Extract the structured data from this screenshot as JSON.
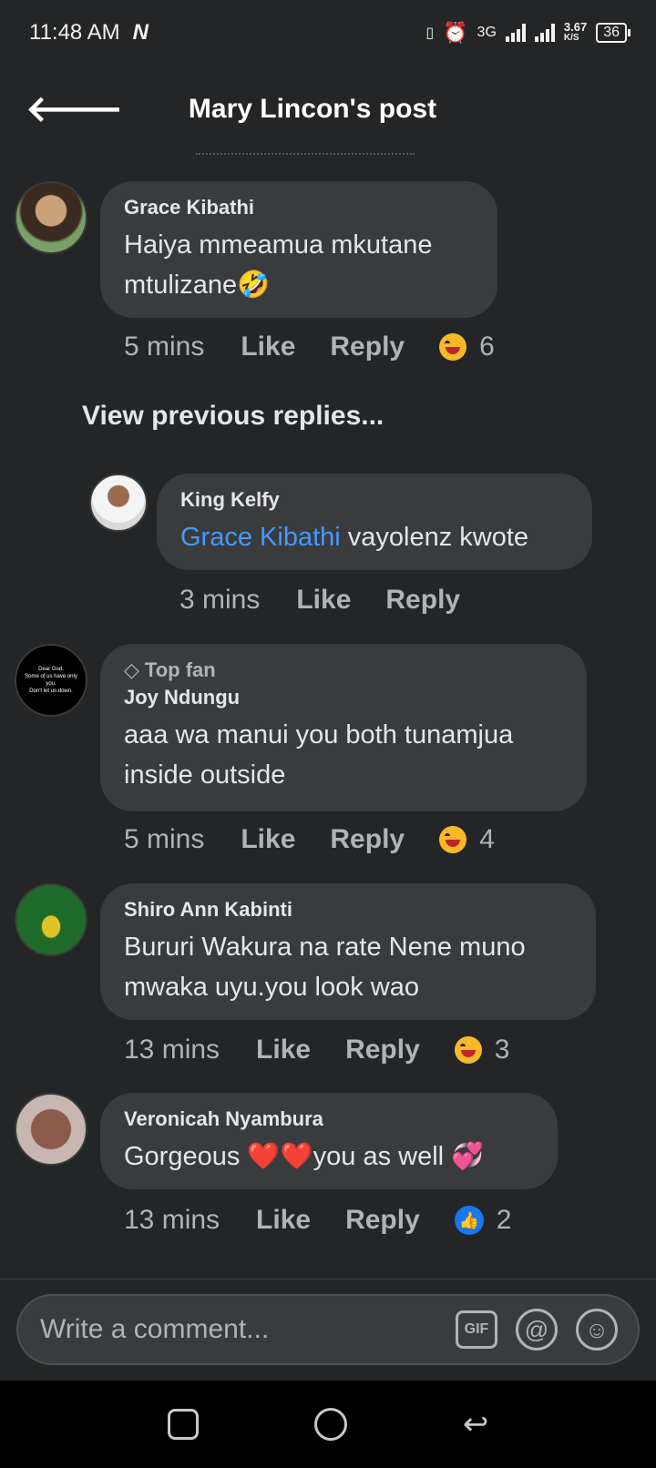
{
  "status": {
    "time": "11:48 AM",
    "carrier_logo": "N",
    "net_type": "3G",
    "speed": "3.67",
    "speed_unit": "K/S",
    "battery": "36"
  },
  "header": {
    "title": "Mary Lincon's post"
  },
  "comments": [
    {
      "name": "Grace Kibathi",
      "text": "Haiya mmeamua mkutane mtulizane🤣",
      "time": "5 mins",
      "like": "Like",
      "reply": "Reply",
      "reaction_count": "6",
      "reaction_icon": "haha"
    },
    {
      "name": "King Kelfy",
      "mention": "Grace Kibathi",
      "text": " vayolenz kwote",
      "time": "3 mins",
      "like": "Like",
      "reply": "Reply"
    },
    {
      "badge": "Top fan",
      "name": "Joy Ndungu",
      "text": "aaa wa manui you both tunamjua inside outside",
      "time": "5 mins",
      "like": "Like",
      "reply": "Reply",
      "reaction_count": "4",
      "reaction_icon": "haha"
    },
    {
      "name": "Shiro Ann Kabinti",
      "text": "Bururi Wakura na rate Nene muno mwaka uyu.you look wao",
      "time": "13 mins",
      "like": "Like",
      "reply": "Reply",
      "reaction_count": "3",
      "reaction_icon": "haha"
    },
    {
      "name": "Veronicah Nyambura",
      "text": "Gorgeous ❤️❤️you as well 💞",
      "time": "13 mins",
      "like": "Like",
      "reply": "Reply",
      "reaction_count": "2",
      "reaction_icon": "like"
    }
  ],
  "view_previous": "View previous replies...",
  "composer": {
    "placeholder": "Write a comment...",
    "gif_label": "GIF"
  }
}
